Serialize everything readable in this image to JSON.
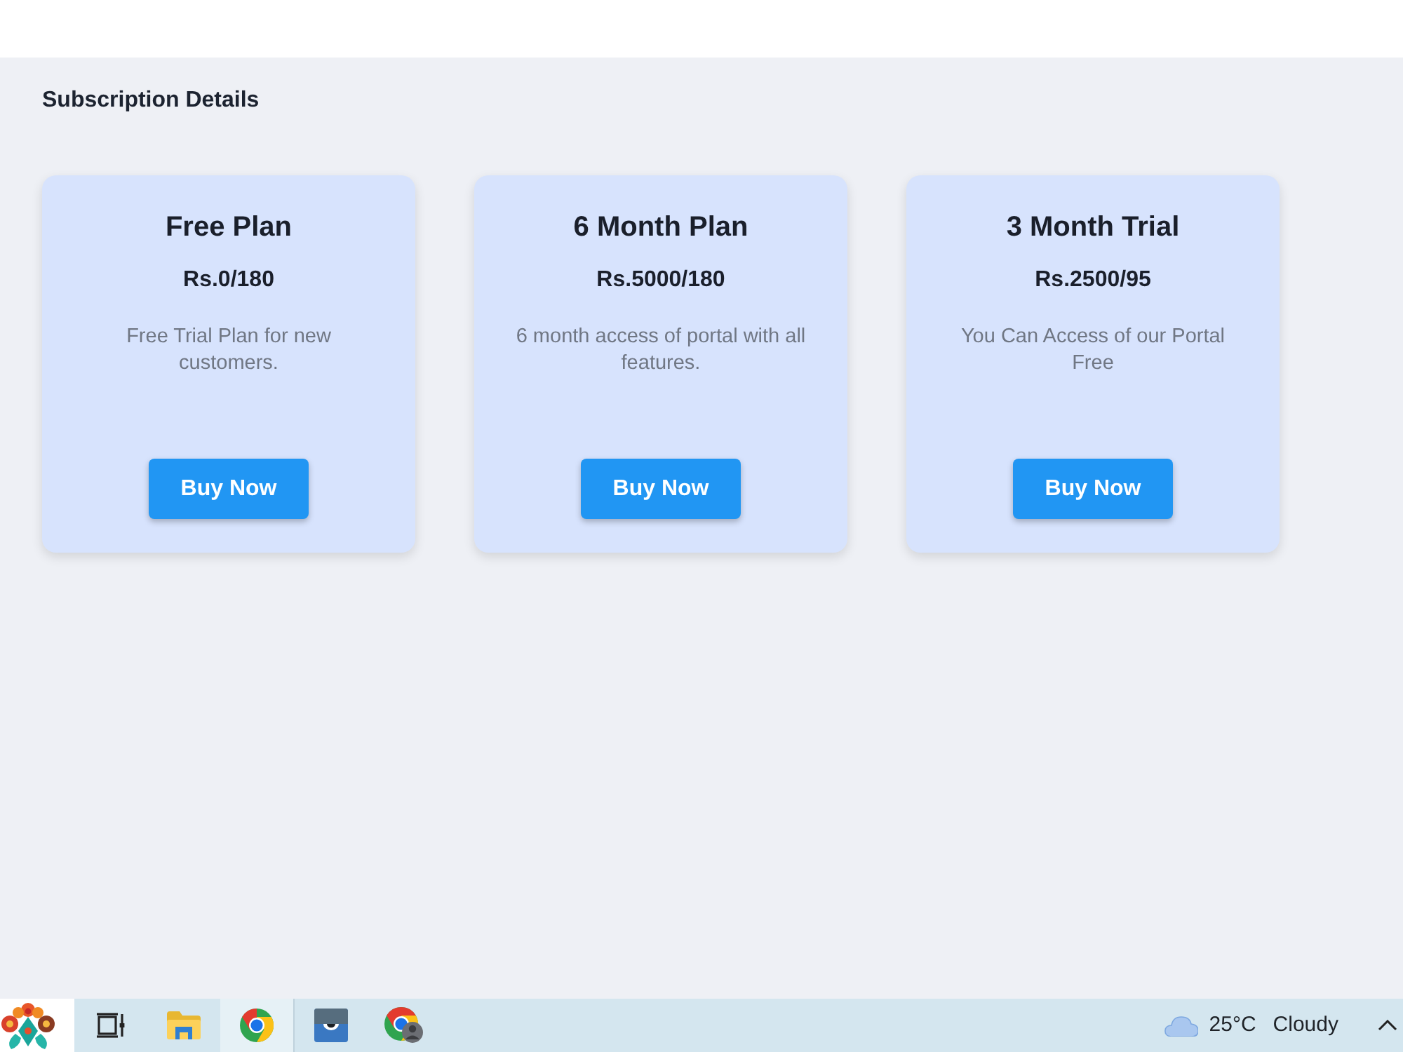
{
  "page": {
    "title": "Subscription Details"
  },
  "plans": [
    {
      "name": "Free Plan",
      "price": "Rs.0/180",
      "description": "Free Trial Plan for new customers.",
      "button": "Buy Now"
    },
    {
      "name": "6 Month Plan",
      "price": "Rs.5000/180",
      "description": "6 month access of portal with all features.",
      "button": "Buy Now"
    },
    {
      "name": "3 Month Trial",
      "price": "Rs.2500/95",
      "description": "You Can Access of our Portal Free",
      "button": "Buy Now"
    }
  ],
  "taskbar": {
    "items": [
      {
        "kind": "logo",
        "selected": false
      },
      {
        "kind": "taskview",
        "selected": false
      },
      {
        "kind": "folder",
        "selected": false
      },
      {
        "kind": "browser",
        "selected": true
      },
      {
        "kind": "app",
        "selected": false
      },
      {
        "kind": "profile",
        "selected": false
      }
    ],
    "weather": {
      "temperature": "25°C",
      "condition": "Cloudy"
    }
  }
}
